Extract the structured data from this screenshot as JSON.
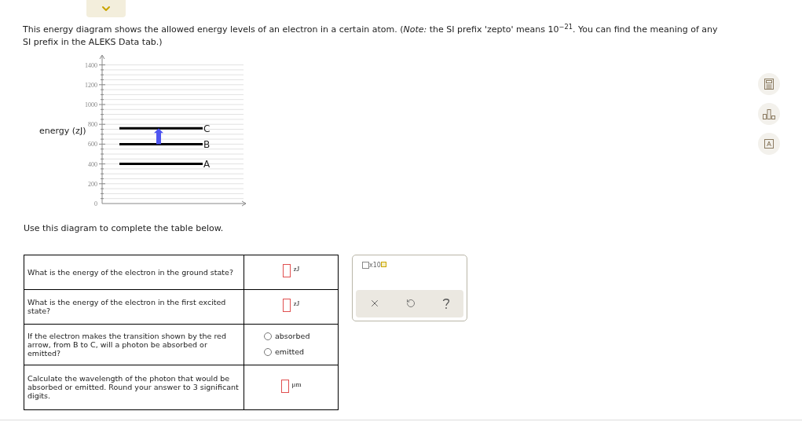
{
  "intro": "This energy diagram shows the allowed energy levels of an electron in a certain atom. (*Note:* the SI prefix 'zepto' means 10$^{−21}$. You can find the meaning of any SI prefix in the ALEKS Data tab.)",
  "diagram": {
    "chart_data": {
      "type": "line",
      "ylabel": "energy (zJ)",
      "categories": [
        null,
        null,
        null
      ],
      "ylim": [
        0,
        1500
      ],
      "yticks": [
        0,
        200,
        400,
        600,
        800,
        1000,
        1200,
        1400
      ],
      "series": [
        {
          "name": "A",
          "color": "#000000",
          "values": [
            400,
            400,
            400
          ]
        },
        {
          "name": "B",
          "color": "#000000",
          "values": [
            600,
            600,
            600
          ]
        },
        {
          "name": "C",
          "color": "#000000",
          "values": [
            760,
            760,
            760
          ]
        }
      ],
      "grid": true
    }
  },
  "instruction": "Use this diagram to complete the table below.",
  "questions": [
    {
      "kind": "input",
      "text": "What is the energy of the electron in the ground state?",
      "unit": "zJ"
    },
    {
      "kind": "input",
      "text": "What is the energy of the electron in the first excited state?",
      "unit": "zJ"
    },
    {
      "kind": "choice",
      "text": "If the electron makes the transition shown by the red arrow, from B to C, will a photon be absorbed or emitted?",
      "options": [
        {
          "label": "absorbed",
          "selected": false
        },
        {
          "label": "emitted",
          "selected": false
        }
      ]
    },
    {
      "kind": "input",
      "text": "Calculate the wavelength of the photon that would be absorbed or emitted. Round your answer to 3 significant digits.",
      "unit": "μm"
    }
  ],
  "palette": {
    "exponent_label": "x10"
  }
}
